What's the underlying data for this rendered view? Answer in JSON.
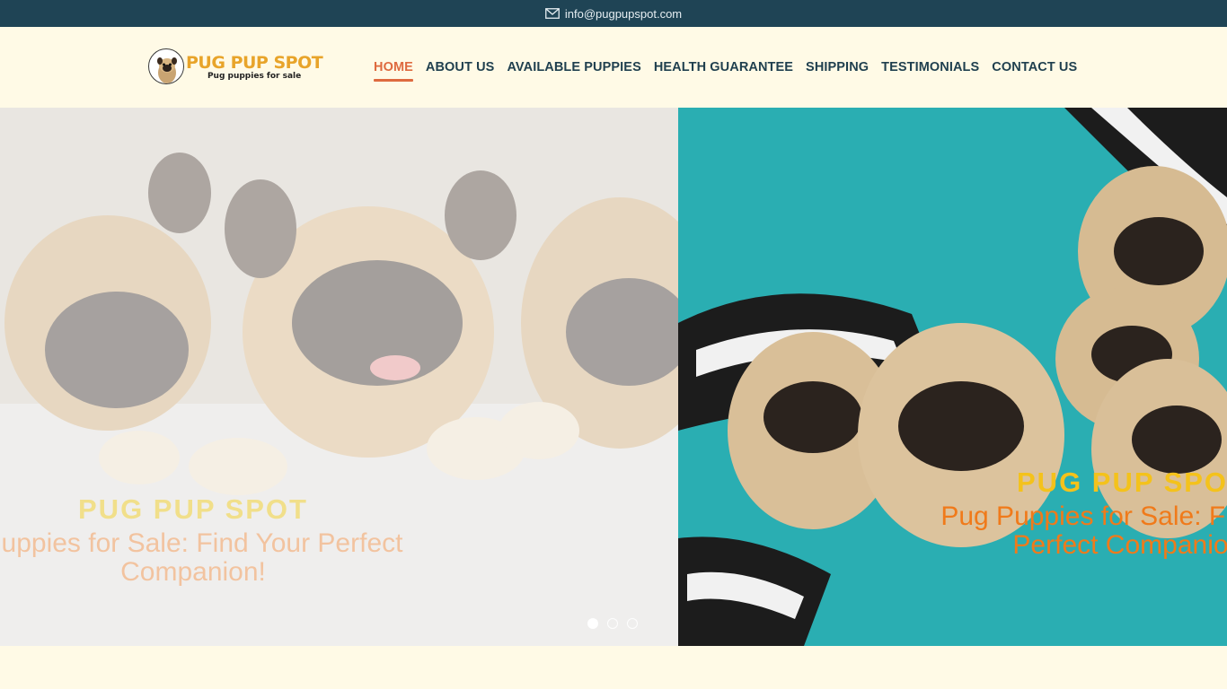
{
  "topbar": {
    "email": "info@pugpupspot.com",
    "icon": "envelope-icon"
  },
  "logo": {
    "name": "PUG PUP SPOT",
    "tagline": "Pug puppies for sale",
    "brand_color": "#e8a42a"
  },
  "nav": {
    "items": [
      {
        "label": "HOME",
        "active": true
      },
      {
        "label": "ABOUT US",
        "active": false
      },
      {
        "label": "AVAILABLE PUPPIES",
        "active": false
      },
      {
        "label": "HEALTH GUARANTEE",
        "active": false
      },
      {
        "label": "SHIPPING",
        "active": false
      },
      {
        "label": "TESTIMONIALS",
        "active": false
      },
      {
        "label": "CONTACT US",
        "active": false
      }
    ],
    "active_color": "#de6a3f",
    "text_color": "#1f3f4e"
  },
  "slider": {
    "slides": [
      {
        "title": "PUG PUP SPOT",
        "subtitle": "Puppies for Sale: Find Your Perfect Companion!"
      },
      {
        "title": "PUG PUP SPOT",
        "subtitle": "Pug Puppies for Sale: Find Your Perfect Companion!"
      }
    ],
    "dots": 3,
    "active_dot": 0,
    "title_color": "#f4c21b",
    "subtitle_color": "#f07a1a"
  },
  "colors": {
    "topbar_bg": "#1f4455",
    "page_bg": "#fffae6"
  }
}
